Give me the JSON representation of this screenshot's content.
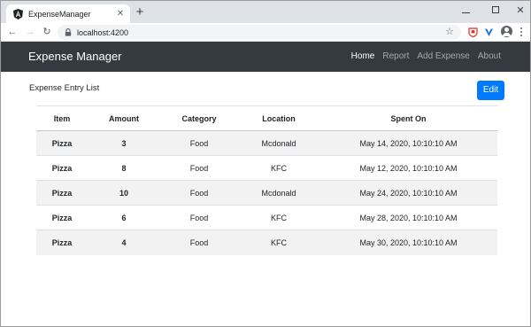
{
  "browser": {
    "tab_title": "ExpenseManager",
    "url": "localhost:4200"
  },
  "navbar": {
    "brand": "Expense Manager",
    "links": [
      "Home",
      "Report",
      "Add Expense",
      "About"
    ]
  },
  "main": {
    "heading": "Expense Entry List",
    "edit_label": "Edit",
    "columns": [
      "Item",
      "Amount",
      "Category",
      "Location",
      "Spent On"
    ],
    "rows": [
      [
        "Pizza",
        "3",
        "Food",
        "Mcdonald",
        "May 14, 2020, 10:10:10 AM"
      ],
      [
        "Pizza",
        "8",
        "Food",
        "KFC",
        "May 12, 2020, 10:10:10 AM"
      ],
      [
        "Pizza",
        "10",
        "Food",
        "Mcdonald",
        "May 24, 2020, 10:10:10 AM"
      ],
      [
        "Pizza",
        "6",
        "Food",
        "KFC",
        "May 28, 2020, 10:10:10 AM"
      ],
      [
        "Pizza",
        "4",
        "Food",
        "KFC",
        "May 30, 2020, 10:10:10 AM"
      ]
    ]
  },
  "colors": {
    "navbar_bg": "#343a40",
    "edit_button": "#007bff",
    "striped_row": "#f2f2f2"
  },
  "icons": [
    "angular-favicon-icon",
    "close-icon",
    "new-tab-icon",
    "back-arrow-icon",
    "forward-arrow-icon",
    "reload-icon",
    "lock-icon",
    "star-icon",
    "extension-icon",
    "profile-icon",
    "kebab-menu-icon"
  ]
}
